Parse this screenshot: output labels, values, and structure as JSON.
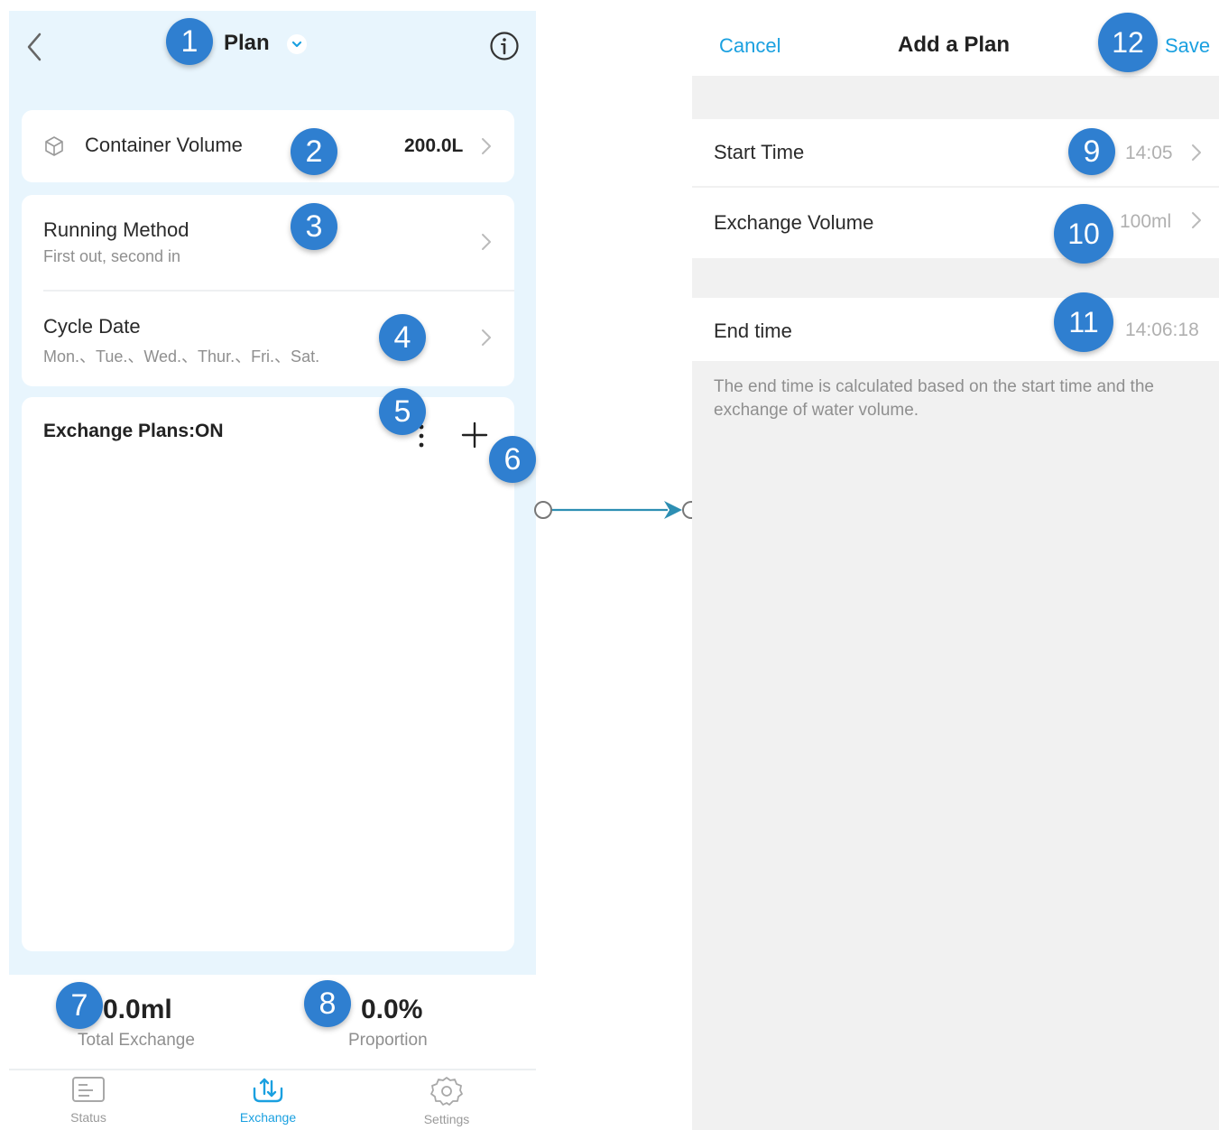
{
  "plan_screen": {
    "header": {
      "title": "Plan"
    },
    "container_volume": {
      "label": "Container Volume",
      "value": "200.0L"
    },
    "running_method": {
      "label": "Running Method",
      "value": "First out, second in"
    },
    "cycle_date": {
      "label": "Cycle Date",
      "value": "Mon.、Tue.、Wed.、Thur.、Fri.、Sat."
    },
    "exchange_plans": {
      "label": "Exchange Plans:ON"
    },
    "stats": {
      "total_exchange_value": "0.0ml",
      "total_exchange_label": "Total Exchange",
      "proportion_value": "0.0%",
      "proportion_label": "Proportion"
    },
    "bottom_nav": [
      {
        "label": "Status",
        "icon": "status-icon",
        "active": false
      },
      {
        "label": "Exchange",
        "icon": "exchange-icon",
        "active": true
      },
      {
        "label": "Settings",
        "icon": "gear-icon",
        "active": false
      }
    ]
  },
  "add_plan_screen": {
    "cancel_label": "Cancel",
    "title": "Add a Plan",
    "save_label": "Save",
    "start_time": {
      "label": "Start Time",
      "value": "14:05"
    },
    "exchange_volume": {
      "label": "Exchange Volume",
      "value": "100ml"
    },
    "end_time": {
      "label": "End time",
      "value": "14:06:18"
    },
    "note": "The end time is calculated based on the start time and the exchange of water volume."
  },
  "badges": [
    "1",
    "2",
    "3",
    "4",
    "5",
    "6",
    "7",
    "8",
    "9",
    "10",
    "11",
    "12"
  ],
  "colors": {
    "accent": "#1aa0e0",
    "badge": "#2f7fd0",
    "screen_bg": "#e8f5fd",
    "panel_bg": "#f1f1f1"
  }
}
